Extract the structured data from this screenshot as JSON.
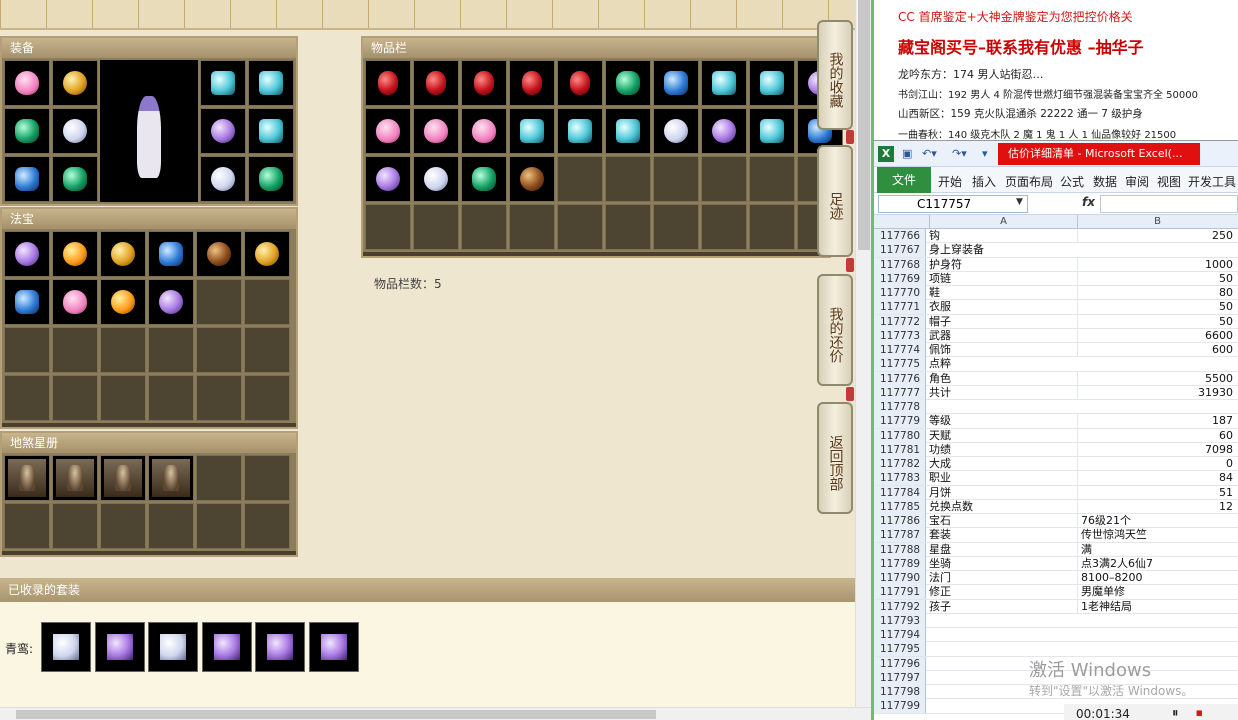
{
  "game": {
    "equip_title": "装备",
    "fabao_title": "法宝",
    "disha_title": "地煞星册",
    "items_title": "物品栏",
    "items_count": "物品栏数：5",
    "suits_title": "已收录的套装",
    "suit_label": "青鸾:",
    "side_buttons": [
      "我的收藏",
      "足迹",
      "我的还价",
      "返回顶部"
    ],
    "equip_items": [
      "pink",
      "gold",
      "green",
      "white",
      "blue",
      "green",
      "cyan",
      "cyan",
      "violet",
      "cyan",
      "white",
      "green"
    ],
    "bag_row1": [
      "red",
      "red",
      "red",
      "red",
      "red",
      "green",
      "blue",
      "cyan",
      "cyan",
      "violet"
    ],
    "bag_row2": [
      "pink",
      "pink",
      "pink",
      "cyan",
      "cyan",
      "cyan",
      "white",
      "violet",
      "cyan",
      "blue"
    ],
    "bag_row3": [
      "violet",
      "white",
      "green",
      "brown"
    ],
    "fabao_items": [
      "violet",
      "orange",
      "gold",
      "blue",
      "brown",
      "gold",
      "blue",
      "pink",
      "orange",
      "violet"
    ],
    "suit_items": [
      "white",
      "violet",
      "white",
      "violet",
      "violet",
      "violet"
    ]
  },
  "doc": {
    "line1": "CC 首席鉴定+大神金牌鉴定为您把控价格关",
    "line2": "藏宝阁买号–联系我有优惠 –抽华子",
    "line3": "龙吟东方：174 男人站街忍…",
    "line4": "书剑江山：192 男人 4 阶混传世燃灯细节强混装备宝宝齐全 50000",
    "line5": "山西新区：159 克火队混通杀 22222 通一 7 级护身",
    "line6": "一曲春秋：140 级克木队 2 魔 1 鬼 1 人 1 仙品像较好 21500"
  },
  "excel": {
    "title": "估价详细清单 - Microsoft Excel(...",
    "file_tab": "文件",
    "tabs": [
      "开始",
      "插入",
      "页面布局",
      "公式",
      "数据",
      "审阅",
      "视图",
      "开发工具"
    ],
    "name_box": "C117757",
    "fx": "fx",
    "col_a": "A",
    "col_b": "B",
    "rows": [
      {
        "n": "117766",
        "a": "钩",
        "b": "250",
        "t": "num"
      },
      {
        "n": "117767",
        "a": "身上穿装备",
        "b": "",
        "t": "num"
      },
      {
        "n": "117768",
        "a": "护身符",
        "b": "1000",
        "t": "num"
      },
      {
        "n": "117769",
        "a": "项链",
        "b": "50",
        "t": "num"
      },
      {
        "n": "117770",
        "a": "鞋",
        "b": "80",
        "t": "num"
      },
      {
        "n": "117771",
        "a": "衣服",
        "b": "50",
        "t": "num"
      },
      {
        "n": "117772",
        "a": "帽子",
        "b": "50",
        "t": "num"
      },
      {
        "n": "117773",
        "a": "武器",
        "b": "6600",
        "t": "num"
      },
      {
        "n": "117774",
        "a": "佩饰",
        "b": "600",
        "t": "num"
      },
      {
        "n": "117775",
        "a": "点粹",
        "b": "",
        "t": "num"
      },
      {
        "n": "117776",
        "a": "角色",
        "b": "5500",
        "t": "num"
      },
      {
        "n": "117777",
        "a": "共计",
        "b": "31930",
        "t": "num"
      },
      {
        "n": "117778",
        "a": "",
        "b": "",
        "t": "num"
      },
      {
        "n": "117779",
        "a": "等级",
        "b": "187",
        "t": "num"
      },
      {
        "n": "117780",
        "a": "天赋",
        "b": "60",
        "t": "num"
      },
      {
        "n": "117781",
        "a": "功绩",
        "b": "7098",
        "t": "num"
      },
      {
        "n": "117782",
        "a": "大成",
        "b": "0",
        "t": "num"
      },
      {
        "n": "117783",
        "a": "职业",
        "b": "84",
        "t": "num"
      },
      {
        "n": "117784",
        "a": "月饼",
        "b": "51",
        "t": "num"
      },
      {
        "n": "117785",
        "a": "兑换点数",
        "b": "12",
        "t": "num"
      },
      {
        "n": "117786",
        "a": "宝石",
        "b": "76级21个",
        "t": "txt"
      },
      {
        "n": "117787",
        "a": "套装",
        "b": "传世惊鸿天竺",
        "t": "txt"
      },
      {
        "n": "117788",
        "a": "星盘",
        "b": "满",
        "t": "txt"
      },
      {
        "n": "117789",
        "a": "坐骑",
        "b": "点3满2人6仙7",
        "t": "txt"
      },
      {
        "n": "117790",
        "a": "法门",
        "b": "8100–8200",
        "t": "txt"
      },
      {
        "n": "117791",
        "a": "修正",
        "b": "男魔单修",
        "t": "txt"
      },
      {
        "n": "117792",
        "a": "孩子",
        "b": "1老神结局",
        "t": "txt"
      },
      {
        "n": "117793",
        "a": "",
        "b": "",
        "t": "txt"
      },
      {
        "n": "117794",
        "a": "",
        "b": "",
        "t": "txt"
      },
      {
        "n": "117795",
        "a": "",
        "b": "",
        "t": "txt"
      },
      {
        "n": "117796",
        "a": "",
        "b": "",
        "t": "txt"
      },
      {
        "n": "117797",
        "a": "",
        "b": "",
        "t": "txt"
      },
      {
        "n": "117798",
        "a": "",
        "b": "",
        "t": "txt"
      },
      {
        "n": "117799",
        "a": "",
        "b": "",
        "t": "txt"
      }
    ]
  },
  "overlay": {
    "activate_title": "激活 Windows",
    "activate_sub": "转到\"设置\"以激活 Windows。",
    "timer": "00:01:34"
  }
}
